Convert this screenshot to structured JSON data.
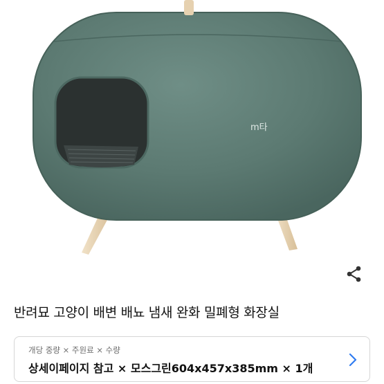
{
  "product": {
    "image_alt": "green cat litter box",
    "logo_text": "m타",
    "title": "반려묘 고양이 배변 배뇨 냄새 완화 밀폐형 화장실"
  },
  "share": {
    "icon": "share-icon"
  },
  "option": {
    "label": "개당 중량 × 주원료 × 수량",
    "value": "상세이페이지 참고 × 모스그린604x457x385mm × 1개",
    "icon": "chevron-right-icon"
  },
  "colors": {
    "body": "#5c7a72",
    "rim": "#4e6c64",
    "opening": "#2b3130",
    "legs": "#e6d1b0",
    "accent": "#2f7bf0"
  }
}
